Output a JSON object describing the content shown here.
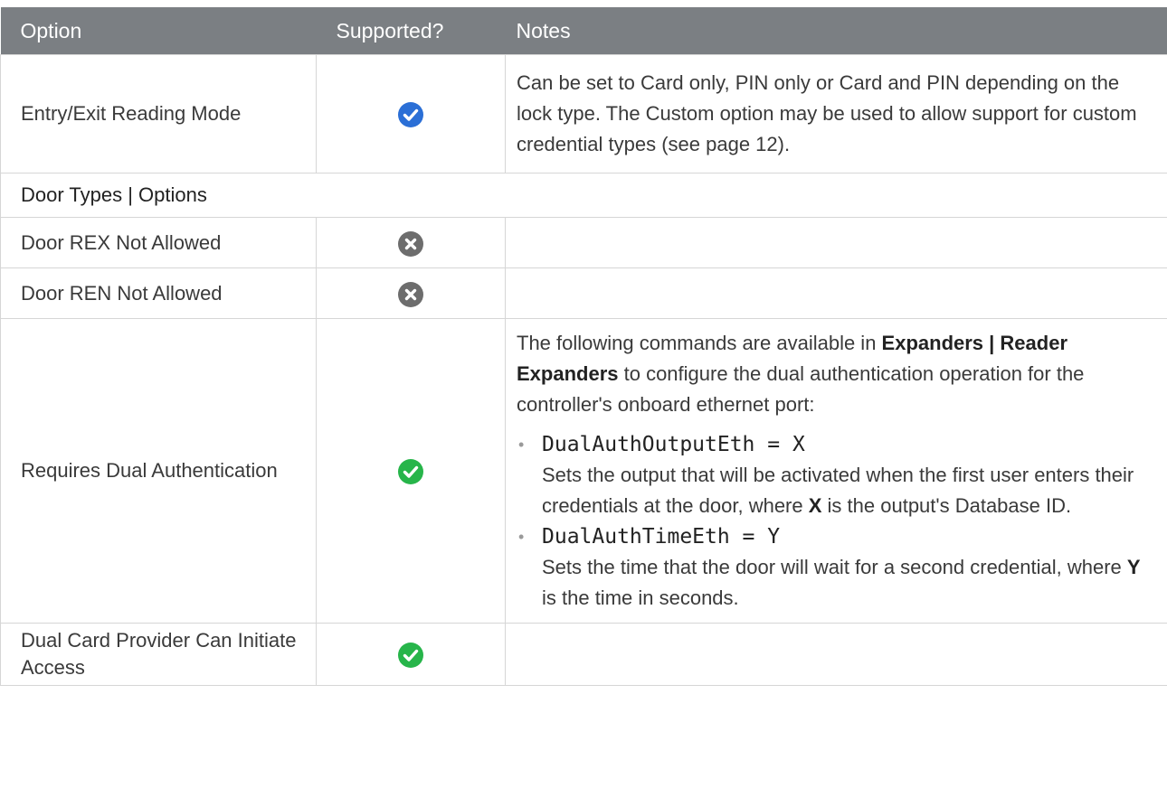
{
  "colors": {
    "header_bg": "#7b7f83",
    "check_blue": "#2b6fd6",
    "check_green": "#27b54a",
    "cross_gray": "#6d6d6d",
    "border": "#d6d6d6"
  },
  "header": {
    "option": "Option",
    "supported": "Supported?",
    "notes": "Notes"
  },
  "rows": [
    {
      "option": "Entry/Exit Reading Mode",
      "supported_icon": "blue-check-icon",
      "notes": "Can be set to Card only, PIN only or Card and PIN depending on the lock type. The Custom option may be used to allow support for custom credential types (see page 12)."
    },
    {
      "section": "Door Types | Options"
    },
    {
      "option": "Door REX Not Allowed",
      "supported_icon": "gray-cross-icon",
      "notes": ""
    },
    {
      "option": "Door REN Not Allowed",
      "supported_icon": "gray-cross-icon",
      "notes": ""
    },
    {
      "option": "Requires Dual Authentication",
      "supported_icon": "green-check-icon",
      "notes_intro_pre": "The following commands are available in ",
      "notes_intro_bold": "Expanders | Reader Expanders",
      "notes_intro_post": " to configure the dual authentication operation for the controller's onboard ethernet port:",
      "commands": [
        {
          "code": "DualAuthOutputEth = X",
          "desc_pre": "Sets the output that will be activated when the first user enters their credentials at the door, where ",
          "desc_bold": "X",
          "desc_post": " is the output's Database ID."
        },
        {
          "code": "DualAuthTimeEth = Y",
          "desc_pre": "Sets the time that the door will wait for a second credential, where ",
          "desc_bold": "Y",
          "desc_post": " is the time in seconds."
        }
      ]
    },
    {
      "option": "Dual Card Provider Can Initiate Access",
      "supported_icon": "green-check-icon",
      "notes": ""
    }
  ]
}
